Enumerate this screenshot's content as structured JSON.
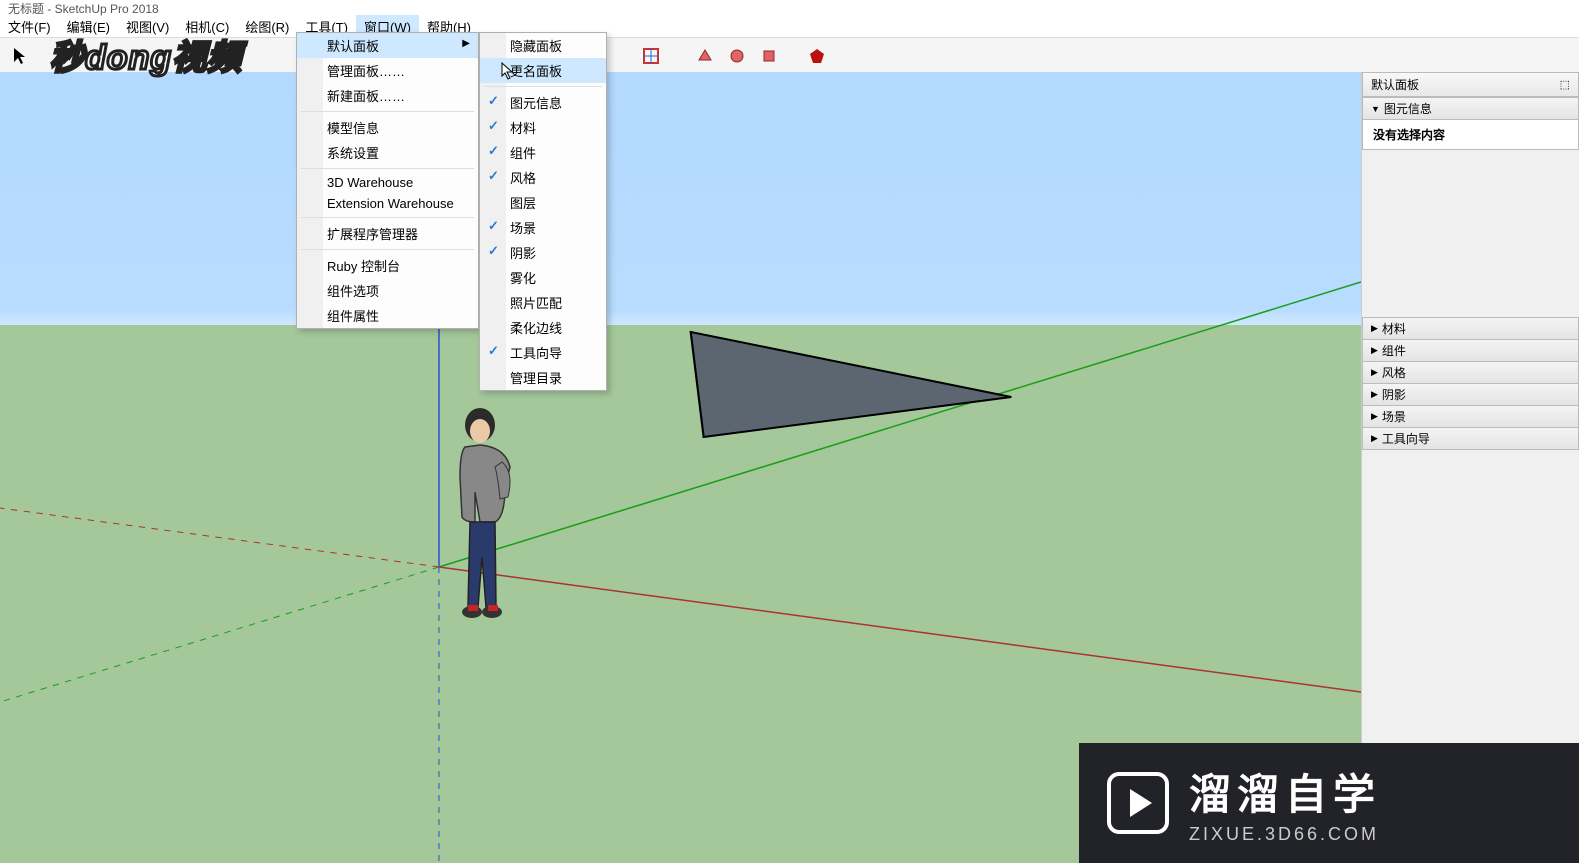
{
  "title": "无标题 - SketchUp Pro 2018",
  "menu": {
    "file": "文件(F)",
    "edit": "编辑(E)",
    "view": "视图(V)",
    "camera": "相机(C)",
    "draw": "绘图(R)",
    "tools": "工具(T)",
    "window": "窗口(W)",
    "help": "帮助(H)"
  },
  "windowMenu": {
    "defaultPanel": "默认面板",
    "managePanel": "管理面板……",
    "newPanel": "新建面板……",
    "modelInfo": "模型信息",
    "systemSettings": "系统设置",
    "warehouse3d": "3D Warehouse",
    "extWarehouse": "Extension Warehouse",
    "extManager": "扩展程序管理器",
    "rubyConsole": "Ruby 控制台",
    "compOptions": "组件选项",
    "compAttrs": "组件属性"
  },
  "submenu": {
    "hidePanel": "隐藏面板",
    "renamePanel": "更名面板",
    "entityInfo": "图元信息",
    "materials": "材料",
    "components": "组件",
    "styles": "风格",
    "layers": "图层",
    "scenes": "场景",
    "shadows": "阴影",
    "fog": "雾化",
    "photoMatch": "照片匹配",
    "softenEdges": "柔化边线",
    "instructor": "工具向导",
    "manageCatalog": "管理目录"
  },
  "rightPanel": {
    "header": "默认面板",
    "entityInfo": "图元信息",
    "noSelection": "没有选择内容",
    "materials": "材料",
    "components": "组件",
    "styles": "风格",
    "shadows": "阴影",
    "scenes": "场景",
    "instructor": "工具向导"
  },
  "ad": {
    "main": "溜溜自学",
    "sub": "ZIXUE.3D66.COM"
  },
  "watermark": "秒dong视频"
}
